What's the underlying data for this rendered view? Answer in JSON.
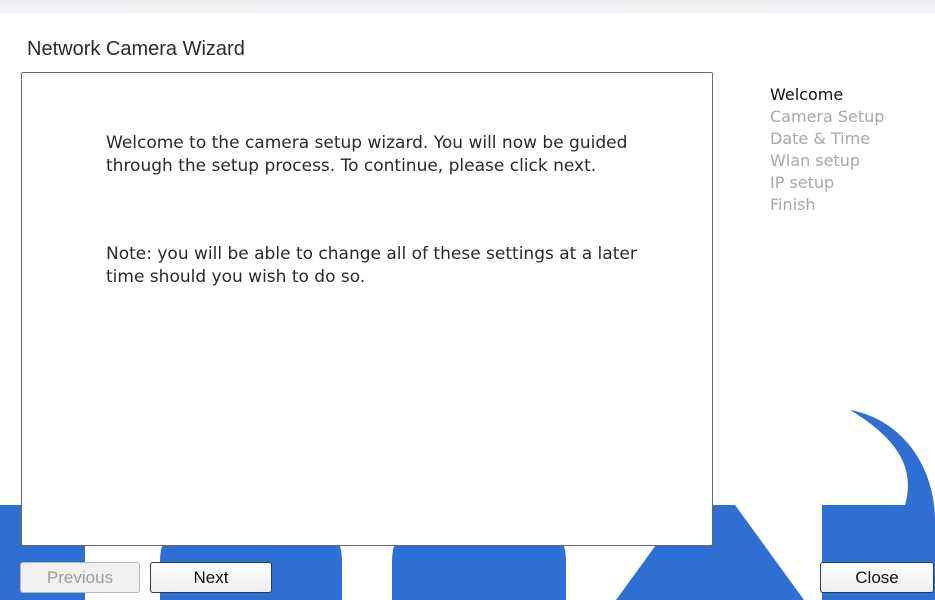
{
  "wizard": {
    "title": "Network Camera Wizard"
  },
  "content": {
    "welcome": "Welcome to the camera setup wizard. You will now be guided through the setup process. To continue, please click next.",
    "note": "Note: you will be able to change all of these settings at a later time should you wish to do so."
  },
  "steps": [
    {
      "label": "Welcome",
      "active": true
    },
    {
      "label": "Camera Setup",
      "active": false
    },
    {
      "label": "Date & Time",
      "active": false
    },
    {
      "label": "Wlan setup",
      "active": false
    },
    {
      "label": "IP setup",
      "active": false
    },
    {
      "label": "Finish",
      "active": false
    }
  ],
  "buttons": {
    "previous": "Previous",
    "next": "Next",
    "close": "Close"
  },
  "colors": {
    "watermark": "#2f6fd3",
    "active_step": "#111111",
    "inactive_step": "#a8a8a8",
    "panel_border": "#6a6a6a"
  }
}
